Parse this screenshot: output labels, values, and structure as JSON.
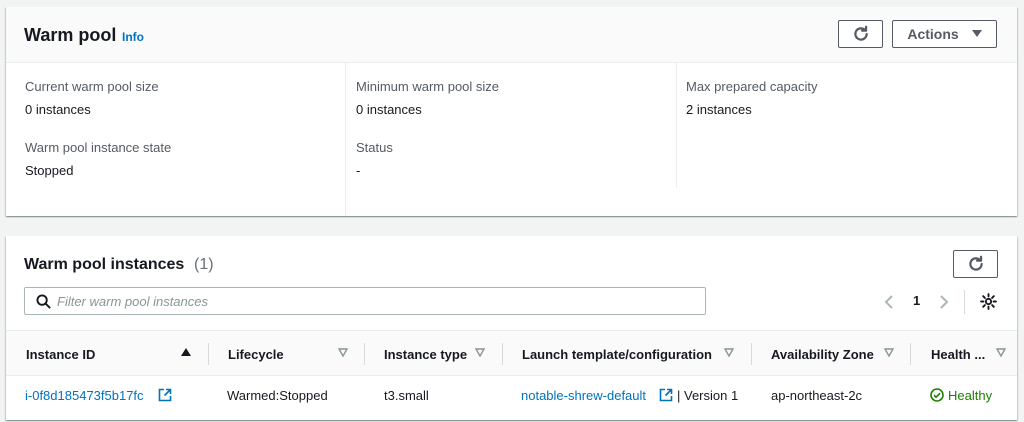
{
  "warm_pool": {
    "title": "Warm pool",
    "info": "Info",
    "actions_label": "Actions",
    "fields": [
      {
        "label": "Current warm pool size",
        "value": "0 instances"
      },
      {
        "label": "Minimum warm pool size",
        "value": "0 instances"
      },
      {
        "label": "Max prepared capacity",
        "value": "2 instances"
      },
      {
        "label": "Warm pool instance state",
        "value": "Stopped"
      },
      {
        "label": "Status",
        "value": "-"
      }
    ]
  },
  "instances": {
    "title": "Warm pool instances",
    "count": "(1)",
    "search_placeholder": "Filter warm pool instances",
    "page": "1",
    "columns": [
      "Instance ID",
      "Lifecycle",
      "Instance type",
      "Launch template/configuration",
      "Availability Zone",
      "Health ..."
    ],
    "rows": [
      {
        "instance_id": "i-0f8d185473f5b17fc",
        "lifecycle": "Warmed:Stopped",
        "instance_type": "t3.small",
        "launch_template": "notable-shrew-default",
        "version": "| Version 1",
        "az": "ap-northeast-2c",
        "health": "Healthy"
      }
    ]
  },
  "colors": {
    "link": "#0073bb",
    "healthy": "#1d8102"
  }
}
